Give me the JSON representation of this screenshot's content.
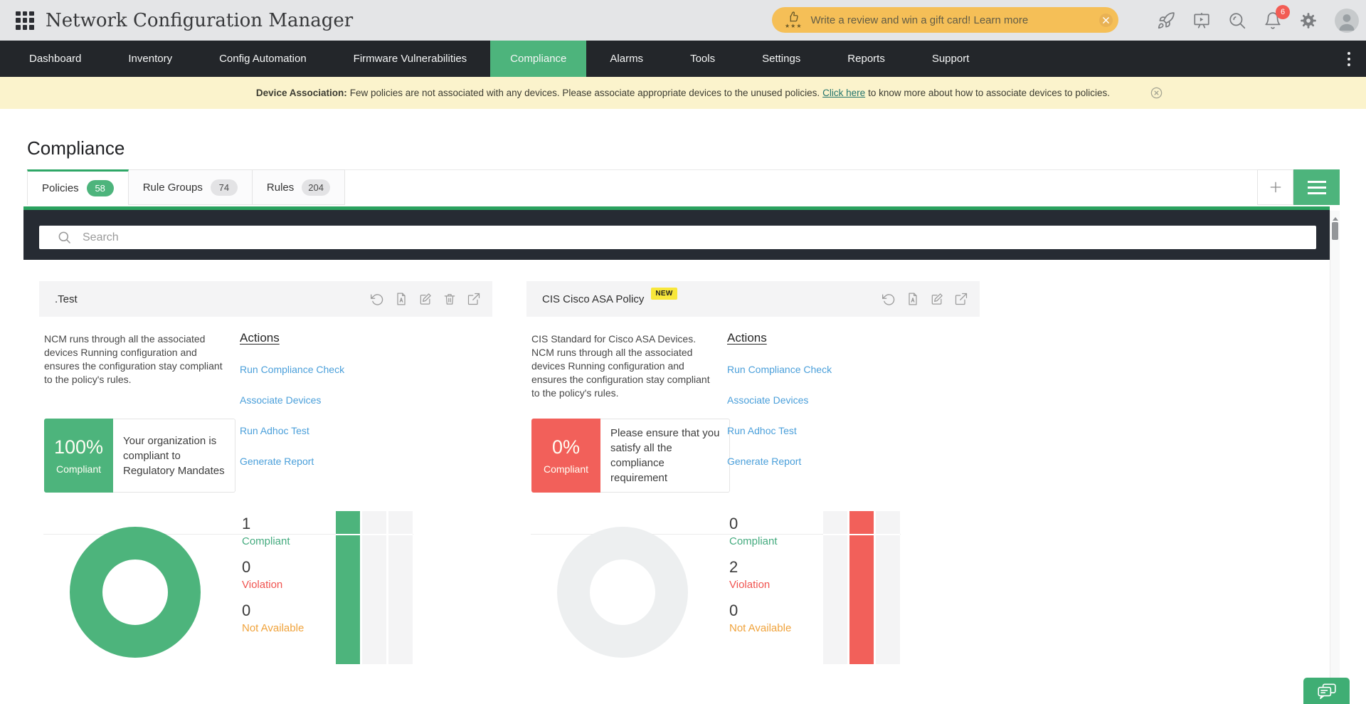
{
  "app_title": "Network Configuration Manager",
  "topbar": {
    "banner_text": "Write a review and win a gift card! Learn more",
    "banner_stars": "★★★",
    "notifications_count": "6"
  },
  "nav": {
    "items": [
      {
        "label": "Dashboard"
      },
      {
        "label": "Inventory"
      },
      {
        "label": "Config Automation"
      },
      {
        "label": "Firmware Vulnerabilities"
      },
      {
        "label": "Compliance"
      },
      {
        "label": "Alarms"
      },
      {
        "label": "Tools"
      },
      {
        "label": "Settings"
      },
      {
        "label": "Reports"
      },
      {
        "label": "Support"
      }
    ],
    "active": "Compliance"
  },
  "notice": {
    "label": "Device Association:",
    "text": "Few policies are not associated with any devices. Please associate appropriate devices to the unused policies.",
    "link": "Click here",
    "suffix": "to know more about how to associate devices to policies."
  },
  "page_title": "Compliance",
  "tabs": [
    {
      "label": "Policies",
      "count": "58"
    },
    {
      "label": "Rule Groups",
      "count": "74"
    },
    {
      "label": "Rules",
      "count": "204"
    }
  ],
  "search_placeholder": "Search",
  "cards": [
    {
      "title": ".Test",
      "badge": "",
      "description": "NCM runs through all the associated\ndevices Running configuration and\nensures the configuration stay compliant\nto the policy's rules.",
      "compliance_percent": "100%",
      "compliance_label": "Compliant",
      "compliance_message": "Your organization is\ncompliant to\nRegulatory Mandates",
      "actions_heading": "Actions",
      "actions": [
        "Run Compliance Check",
        "Associate Devices",
        "Run Adhoc Test",
        "Generate Report"
      ],
      "stats": [
        {
          "value": "1",
          "label": "Compliant"
        },
        {
          "value": "0",
          "label": "Violation"
        },
        {
          "value": "0",
          "label": "Not Available"
        }
      ]
    },
    {
      "title": "CIS Cisco ASA Policy",
      "badge": "NEW",
      "description": "CIS Standard for Cisco ASA Devices.\nNCM runs through all the associated\ndevices Running configuration and\nensures the configuration stay compliant\nto the policy's rules.",
      "compliance_percent": "0%",
      "compliance_label": "Compliant",
      "compliance_message": "Please ensure that you\nsatisfy all the\ncompliance\nrequirement",
      "actions_heading": "Actions",
      "actions": [
        "Run Compliance Check",
        "Associate Devices",
        "Run Adhoc Test",
        "Generate Report"
      ],
      "stats": [
        {
          "value": "0",
          "label": "Compliant"
        },
        {
          "value": "2",
          "label": "Violation"
        },
        {
          "value": "0",
          "label": "Not Available"
        }
      ]
    }
  ],
  "colors": {
    "brand_green": "#4db47c",
    "line_green": "#2aa25f",
    "alert_red": "#f2605a",
    "link_blue": "#4a9fda",
    "warn_orange": "#f0a33c"
  }
}
